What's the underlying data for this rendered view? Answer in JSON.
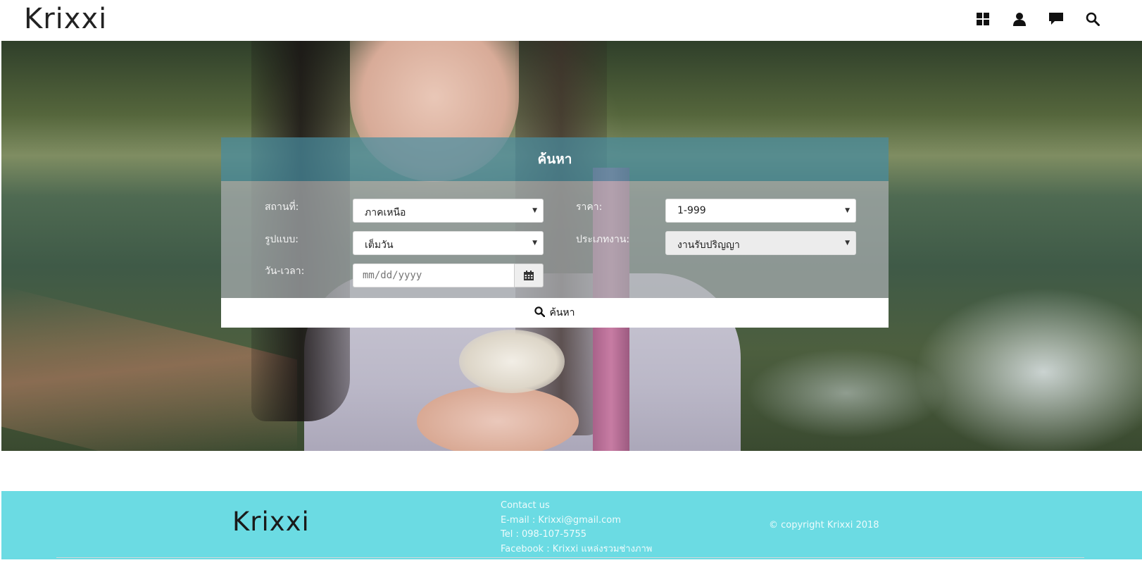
{
  "header": {
    "logo": "Krixxi",
    "icons": [
      "grid-icon",
      "user-icon",
      "chat-icon",
      "search-icon"
    ]
  },
  "search_panel": {
    "title": "ค้นหา",
    "fields": {
      "location": {
        "label": "สถานที่:",
        "value": "ภาคเหนือ"
      },
      "price": {
        "label": "ราคา:",
        "value": "1-999"
      },
      "format": {
        "label": "รูปแบบ:",
        "value": "เต็มวัน"
      },
      "job_type": {
        "label": "ประเภทงาน:",
        "value": "งานรับปริญญา"
      },
      "datetime": {
        "label": "วัน-เวลา:",
        "placeholder": "mm/dd/yyyy"
      }
    },
    "button_label": "ค้นหา"
  },
  "footer": {
    "logo": "Krixxi",
    "contact": {
      "heading": "Contact us",
      "email": "E-mail : Krixxi@gmail.com",
      "tel": "Tel : 098-107-5755",
      "facebook": "Facebook : Krixxi แหล่งรวมช่างภาพ"
    },
    "copyright": "© copyright Krixxi 2018"
  },
  "colors": {
    "footer_bg": "#6bdbe3",
    "panel_header": "#488ca0",
    "panel_body": "#aaafb2"
  }
}
